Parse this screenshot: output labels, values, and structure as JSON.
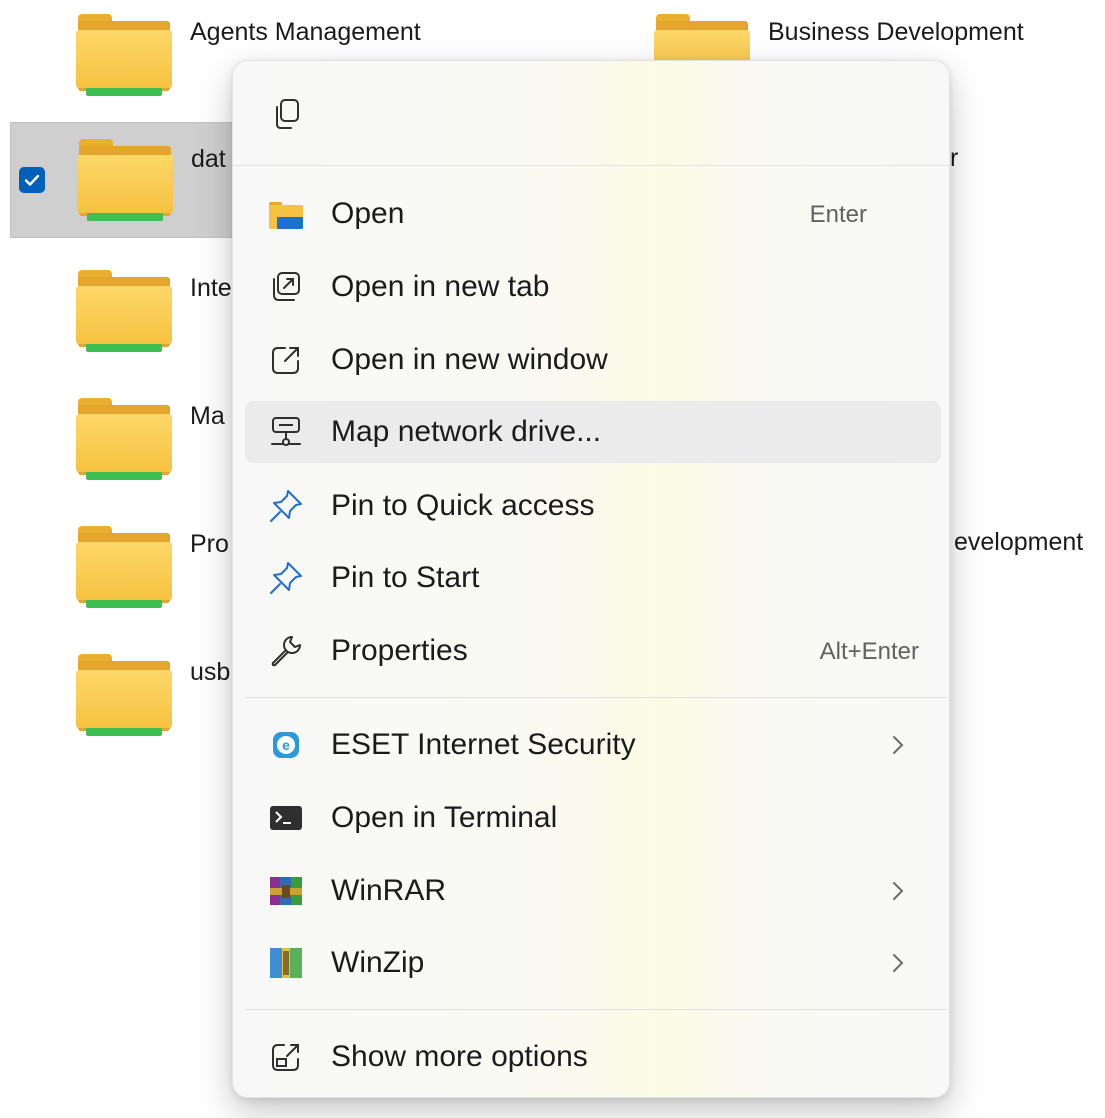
{
  "folders": [
    {
      "label": "Agents Management"
    },
    {
      "label": "Business Development"
    },
    {
      "label": "dat"
    },
    {
      "label": "r"
    },
    {
      "label": "Inte"
    },
    {
      "label": "Ma"
    },
    {
      "label": "Pro"
    },
    {
      "label": "evelopment"
    },
    {
      "label": "usb"
    }
  ],
  "menu": {
    "top_icon": "copy-icon",
    "items": [
      {
        "label": "Open",
        "shortcut": "Enter",
        "icon": "folder-open-icon"
      },
      {
        "label": "Open in new tab",
        "icon": "new-tab-icon"
      },
      {
        "label": "Open in new window",
        "icon": "new-window-icon"
      },
      {
        "label": "Map network drive...",
        "icon": "network-drive-icon"
      },
      {
        "label": "Pin to Quick access",
        "icon": "pin-icon"
      },
      {
        "label": "Pin to Start",
        "icon": "pin-icon"
      },
      {
        "label": "Properties",
        "shortcut": "Alt+Enter",
        "icon": "wrench-icon"
      },
      {
        "label": "ESET Internet Security",
        "icon": "eset-icon"
      },
      {
        "label": "Open in Terminal",
        "icon": "terminal-icon"
      },
      {
        "label": "WinRAR",
        "icon": "winrar-icon"
      },
      {
        "label": "WinZip",
        "icon": "winzip-icon"
      },
      {
        "label": "Show more options",
        "icon": "show-more-icon"
      }
    ]
  },
  "colors": {
    "accent": "#005fb8",
    "folder_yellow": "#f7c241",
    "folder_green": "#3fbf52",
    "selection": "#cfcfcf",
    "hover": "#ebebeb"
  }
}
